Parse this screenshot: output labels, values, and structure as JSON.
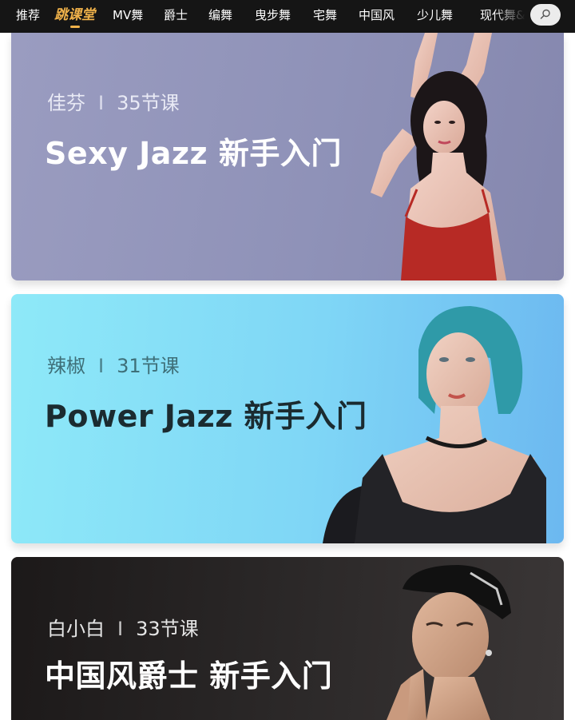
{
  "nav": {
    "tabs": [
      {
        "label": "推荐"
      },
      {
        "label": "跳课堂"
      },
      {
        "label": "MV舞"
      },
      {
        "label": "爵士"
      },
      {
        "label": "编舞"
      },
      {
        "label": "曳步舞"
      },
      {
        "label": "宅舞"
      },
      {
        "label": "中国风"
      },
      {
        "label": "少儿舞"
      },
      {
        "label": "现代舞&"
      }
    ],
    "active_tab": "跳课堂",
    "accent_color": "#f0b24a",
    "search_icon": "search-icon"
  },
  "courses": [
    {
      "teacher": "佳芬",
      "separator": "I",
      "lessons": "35节课",
      "title": "Sexy Jazz 新手入门",
      "image": "dancer-red-top-photo",
      "background": "#9a9cc0"
    },
    {
      "teacher": "辣椒",
      "separator": "I",
      "lessons": "31节课",
      "title": "Power Jazz 新手入门",
      "image": "dancer-teal-hair-photo",
      "background": "#8ee9f8"
    },
    {
      "teacher": "白小白",
      "separator": "I",
      "lessons": "33节课",
      "title": "中国风爵士 新手入门",
      "image": "dancer-cap-photo",
      "background": "#1c1919"
    }
  ]
}
